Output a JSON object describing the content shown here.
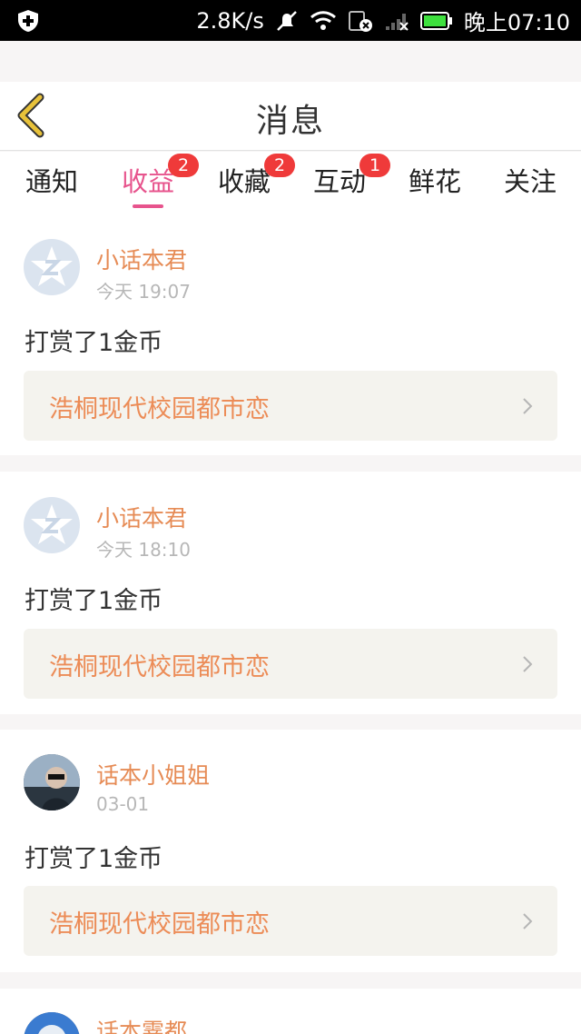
{
  "status_bar": {
    "speed": "2.8K/s",
    "time": "晚上07:10",
    "icons": [
      "shield-plus-icon",
      "mute-bell-icon",
      "wifi-icon",
      "sim-card-icon",
      "signal-icon",
      "battery-icon"
    ]
  },
  "header": {
    "title": "消息",
    "back_icon": "chevron-left-icon"
  },
  "tabs": [
    {
      "label": "通知",
      "badge": null,
      "active": false
    },
    {
      "label": "收益",
      "badge": "2",
      "active": true
    },
    {
      "label": "收藏",
      "badge": "2",
      "active": false
    },
    {
      "label": "互动",
      "badge": "1",
      "active": false
    },
    {
      "label": "鲜花",
      "badge": null,
      "active": false
    },
    {
      "label": "关注",
      "badge": null,
      "active": false
    }
  ],
  "messages": [
    {
      "sender": "小话本君",
      "time": "今天 19:07",
      "text": "打赏了1金币",
      "book": "浩桐现代校园都市恋",
      "avatar": "default-z-star-icon"
    },
    {
      "sender": "小话本君",
      "time": "今天 18:10",
      "text": "打赏了1金币",
      "book": "浩桐现代校园都市恋",
      "avatar": "default-z-star-icon"
    },
    {
      "sender": "话本小姐姐",
      "time": "03-01",
      "text": "打赏了1金币",
      "book": "浩桐现代校园都市恋",
      "avatar": "user-photo"
    },
    {
      "sender": "话本霎都",
      "time": "",
      "text": "",
      "book": "",
      "avatar": "user-photo"
    }
  ],
  "colors": {
    "accent": "#e7548d",
    "sender": "#e68b55",
    "badge": "#ef3a3a",
    "book_bg": "#f4f3ee",
    "back_icon": "#e8c23a"
  }
}
